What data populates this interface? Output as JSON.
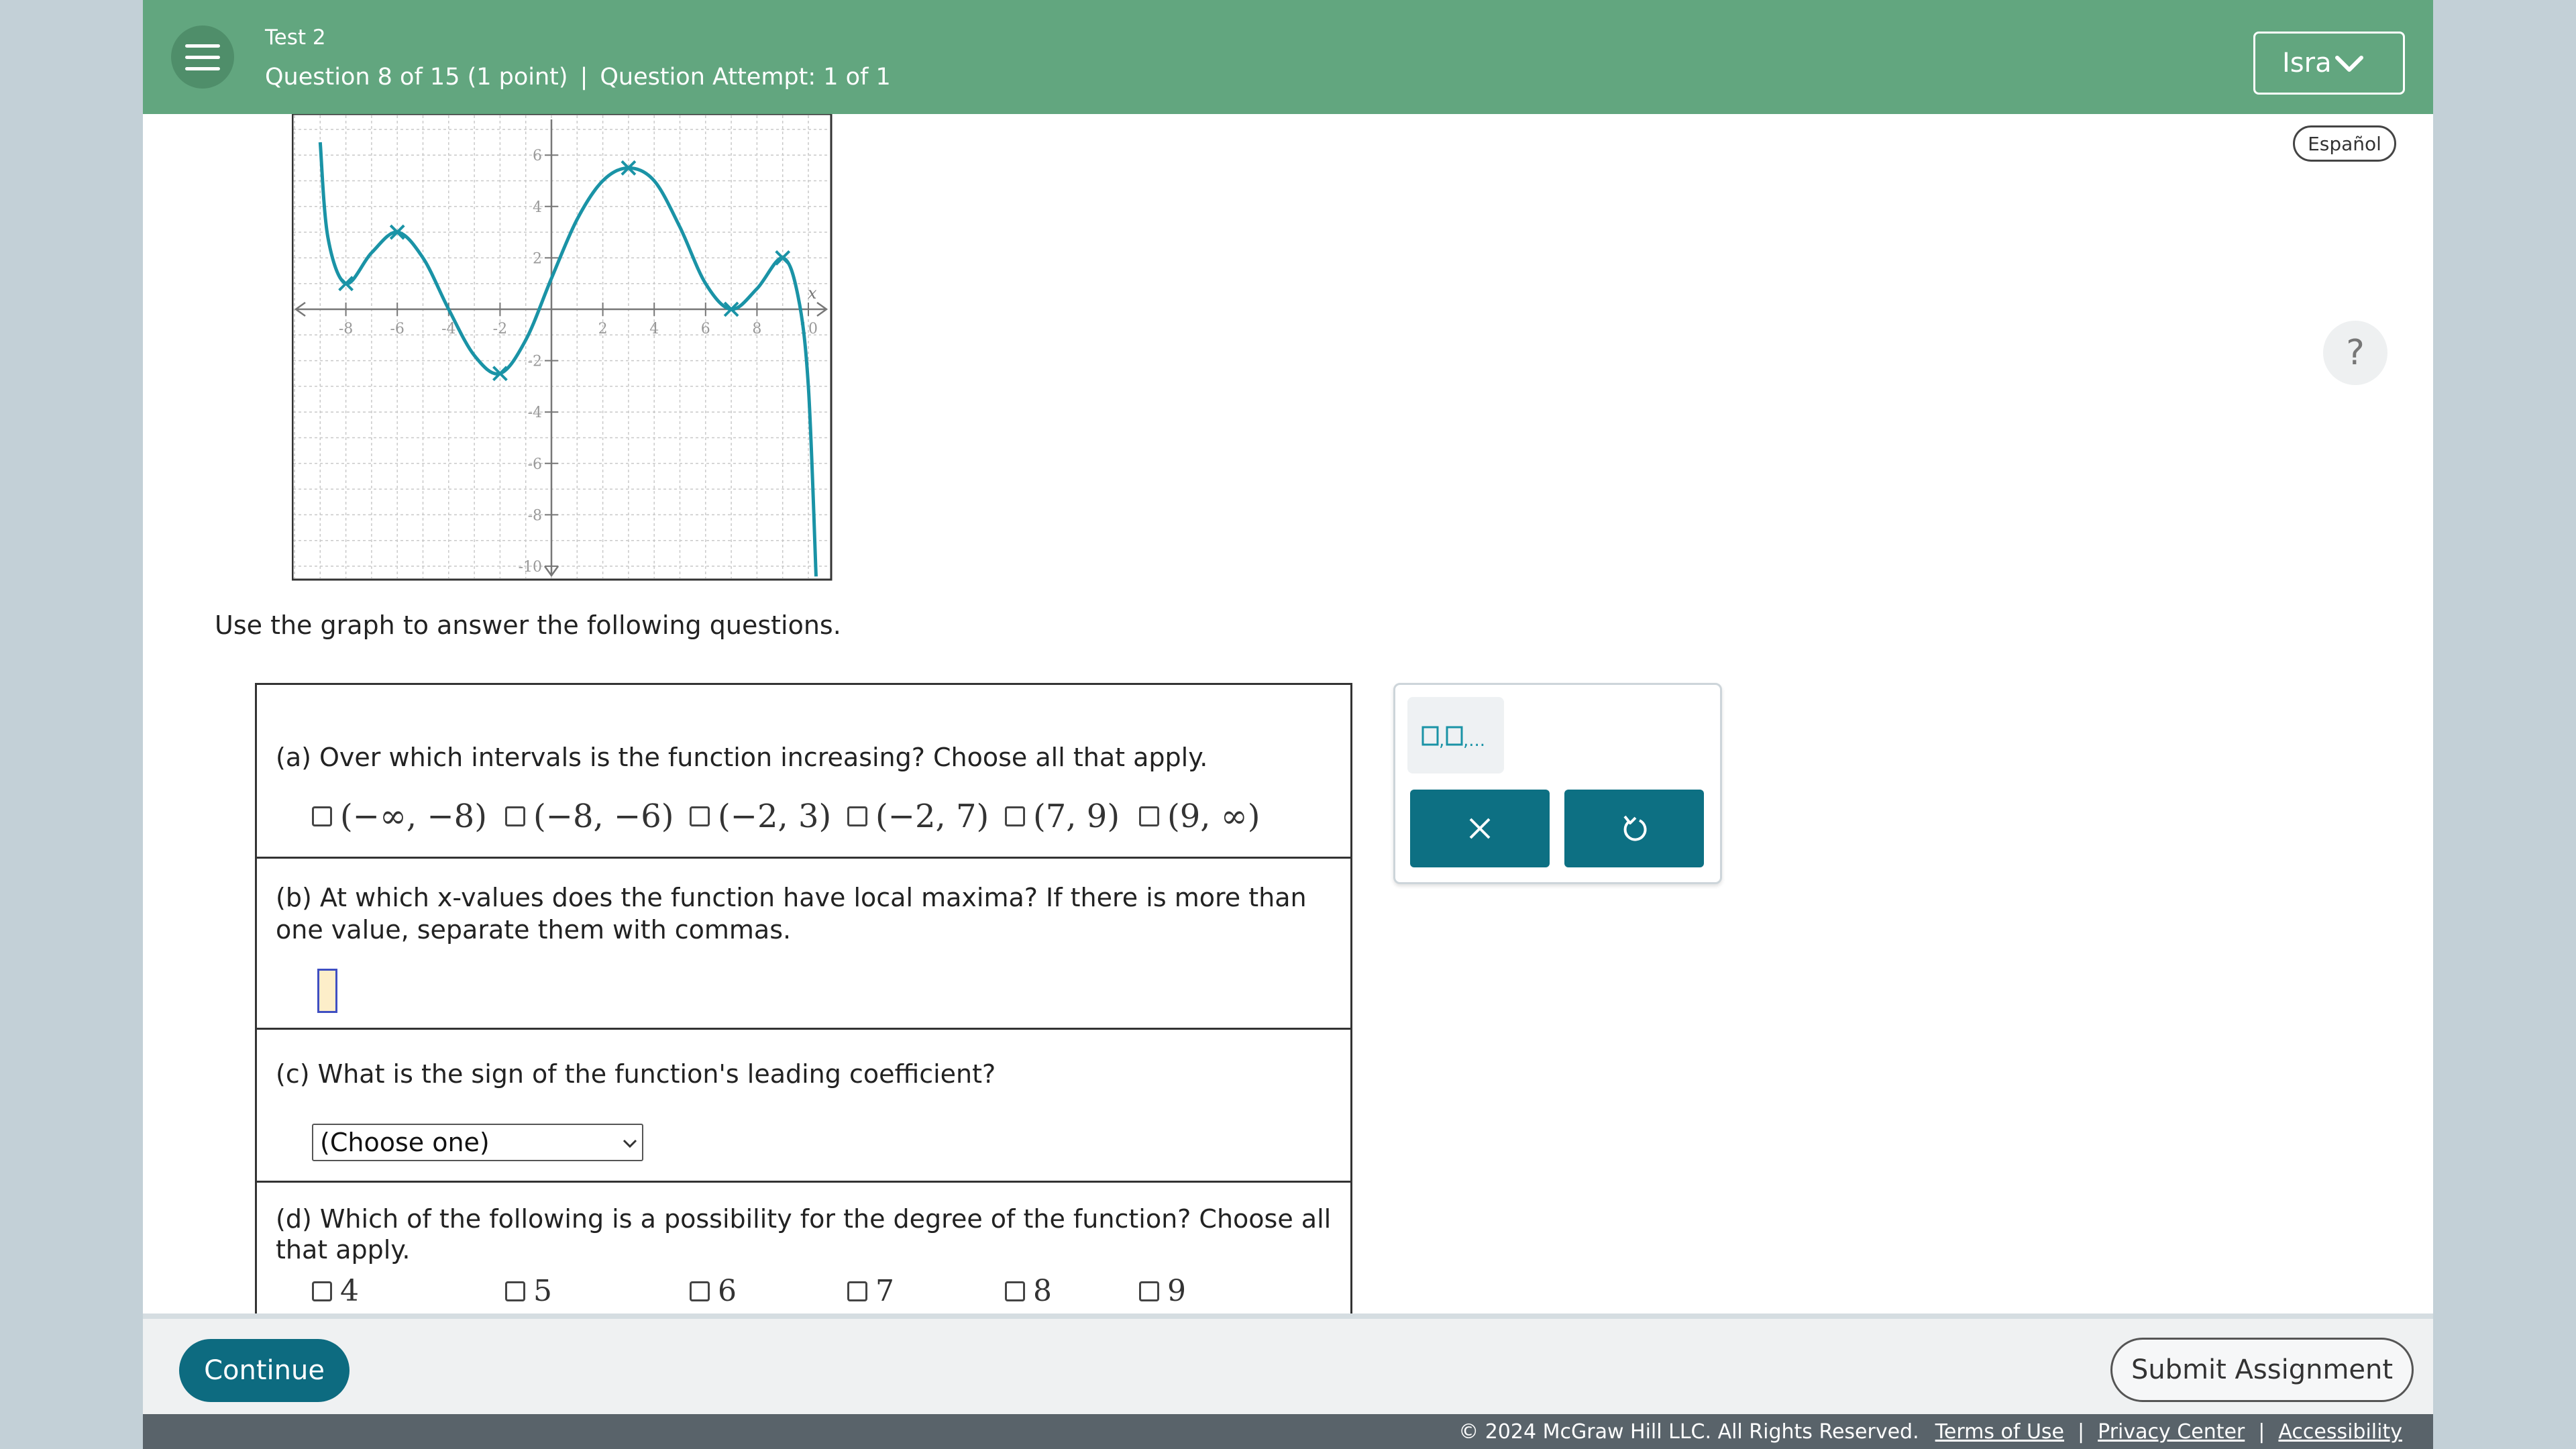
{
  "header": {
    "test_name": "Test 2",
    "question_position": "Question 8 of 15 (1 point)",
    "separator": "|",
    "attempt": "Question Attempt: 1 of 1",
    "user_name": "Isra",
    "colors": {
      "header_bg": "#62a67f",
      "accent": "#0d7083"
    }
  },
  "language_button": "Español",
  "help_label": "?",
  "graph": {
    "axis_label_x": "x",
    "x_ticks": [
      "-8",
      "-6",
      "-4",
      "-2",
      "2",
      "4",
      "6",
      "8",
      "10"
    ],
    "y_ticks": [
      "6",
      "4",
      "2",
      "-2",
      "-4",
      "-6",
      "-8",
      "-10"
    ],
    "chart_data": {
      "type": "line",
      "xlim": [
        -10,
        11
      ],
      "ylim": [
        -10.5,
        7.5
      ],
      "grid": true,
      "curve_color": "#1a93a6",
      "marked_points": [
        {
          "x": -8,
          "y": 1
        },
        {
          "x": -6,
          "y": 3
        },
        {
          "x": -2,
          "y": -2.5
        },
        {
          "x": 3,
          "y": 5.5
        },
        {
          "x": 7,
          "y": 0
        },
        {
          "x": 9,
          "y": 2
        }
      ],
      "curve_points": [
        {
          "x": -9,
          "y": 6.5
        },
        {
          "x": -8.7,
          "y": 2.8
        },
        {
          "x": -8,
          "y": 1
        },
        {
          "x": -7,
          "y": 2.2
        },
        {
          "x": -6,
          "y": 3
        },
        {
          "x": -5,
          "y": 2
        },
        {
          "x": -4,
          "y": 0
        },
        {
          "x": -3,
          "y": -1.8
        },
        {
          "x": -2,
          "y": -2.5
        },
        {
          "x": -1,
          "y": -1.2
        },
        {
          "x": 0,
          "y": 1.2
        },
        {
          "x": 1,
          "y": 3.5
        },
        {
          "x": 2,
          "y": 5
        },
        {
          "x": 3,
          "y": 5.5
        },
        {
          "x": 4,
          "y": 5
        },
        {
          "x": 5,
          "y": 3.2
        },
        {
          "x": 6,
          "y": 1
        },
        {
          "x": 7,
          "y": 0
        },
        {
          "x": 8,
          "y": 0.8
        },
        {
          "x": 9,
          "y": 2
        },
        {
          "x": 9.6,
          "y": 0.5
        },
        {
          "x": 10,
          "y": -3
        },
        {
          "x": 10.3,
          "y": -10.4
        }
      ]
    }
  },
  "instructions": "Use the graph to answer the following questions.",
  "parts": {
    "a": {
      "question": "(a) Over which intervals is the function increasing? Choose all that apply.",
      "options": [
        "(−∞, −8)",
        "(−8, −6)",
        "(−2, 3)",
        "(−2, 7)",
        "(7, 9)",
        "(9, ∞)"
      ]
    },
    "b": {
      "question_line1": "(b) At which x-values does the function have local maxima? If there is more than",
      "question_line2": "one value, separate them with commas.",
      "answer": ""
    },
    "c": {
      "question": "(c) What is the sign of the function's leading coefficient?",
      "select_value": "(Choose one)"
    },
    "d": {
      "question_line1": "(d) Which of the following is a possibility for the degree of the function? Choose all",
      "question_line2": "that apply.",
      "options": [
        "4",
        "5",
        "6",
        "7",
        "8",
        "9"
      ]
    }
  },
  "palette": {
    "tool_label": "□,□,...",
    "clear_icon": "close-icon",
    "undo_icon": "undo-icon"
  },
  "footer": {
    "continue_label": "Continue",
    "submit_label": "Submit Assignment",
    "copyright": "© 2024 McGraw Hill LLC. All Rights Reserved.",
    "links": [
      "Terms of Use",
      "Privacy Center",
      "Accessibility"
    ],
    "link_separator": "|"
  }
}
